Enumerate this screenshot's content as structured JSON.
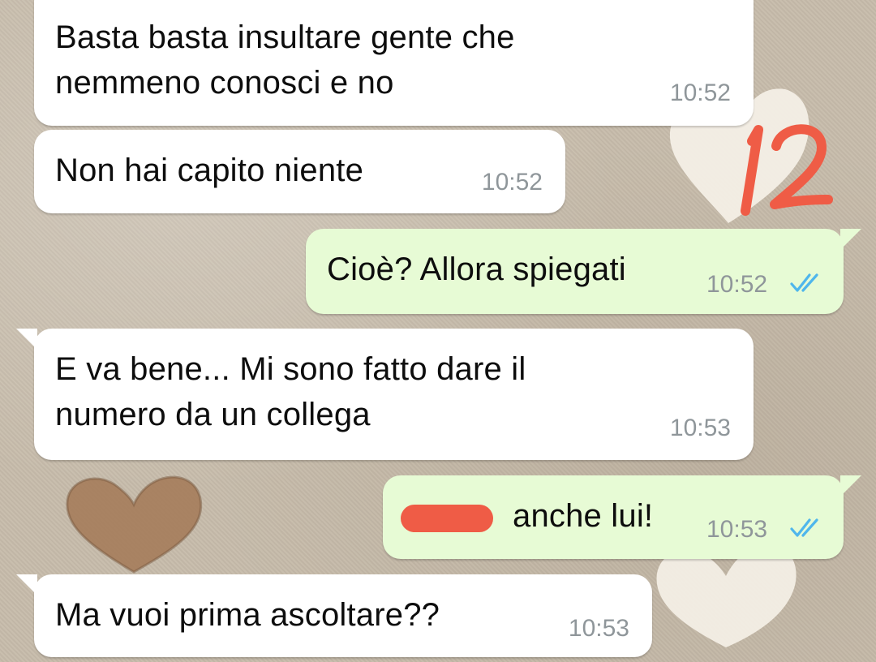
{
  "conversation": {
    "annotation_number": "12",
    "messages": [
      {
        "direction": "incoming",
        "text": "Basta basta insultare gente che\nnemmeno conosci e no",
        "time": "10:52"
      },
      {
        "direction": "incoming",
        "text": "Non hai capito niente",
        "time": "10:52"
      },
      {
        "direction": "outgoing",
        "text": "Cioè? Allora spiegati",
        "time": "10:52",
        "status_icon": "double-check-icon"
      },
      {
        "direction": "incoming",
        "text": "E va bene... Mi sono fatto dare il\nnumero da un collega",
        "time": "10:53"
      },
      {
        "direction": "outgoing",
        "text": "anche lui!",
        "time": "10:53",
        "status_icon": "double-check-icon",
        "redacted_prefix": true
      },
      {
        "direction": "incoming",
        "text": "Ma vuoi prima ascoltare??",
        "time": "10:53"
      }
    ]
  },
  "colors": {
    "incoming_bubble": "#ffffff",
    "outgoing_bubble": "#e7fbd5",
    "timestamp": "#8f969a",
    "read_ticks": "#4fb6ec",
    "redaction_and_annotation": "#ef5c46"
  }
}
